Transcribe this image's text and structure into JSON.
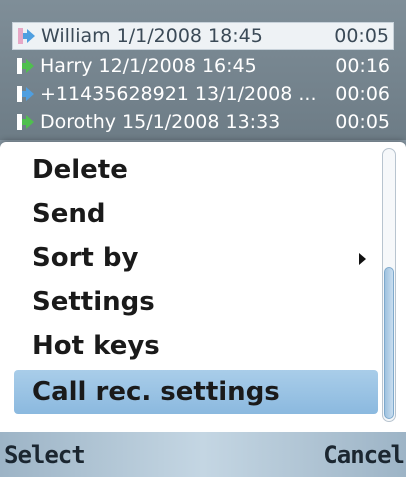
{
  "call_list": [
    {
      "label": "William 1/1/2008 18:45",
      "duration": "00:05",
      "icon": "incoming-call-icon"
    },
    {
      "label": "Harry 12/1/2008 16:45",
      "duration": "00:16",
      "icon": "outgoing-call-icon"
    },
    {
      "label": "+11435628921 13/1/2008 ...",
      "duration": "00:06",
      "icon": "incoming-call-icon"
    },
    {
      "label": "Dorothy 15/1/2008 13:33",
      "duration": "00:05",
      "icon": "outgoing-call-icon"
    }
  ],
  "menu": {
    "items": [
      {
        "label": "Delete"
      },
      {
        "label": "Send"
      },
      {
        "label": "Sort by"
      },
      {
        "label": "Settings"
      },
      {
        "label": "Hot keys"
      },
      {
        "label": "Call rec. settings"
      }
    ],
    "selected_index": 5
  },
  "softkeys": {
    "left": "Select",
    "right": "Cancel"
  },
  "colors": {
    "incoming": "#4f9fe0",
    "outgoing": "#4fbf4f",
    "selection": "#8bb9df"
  }
}
